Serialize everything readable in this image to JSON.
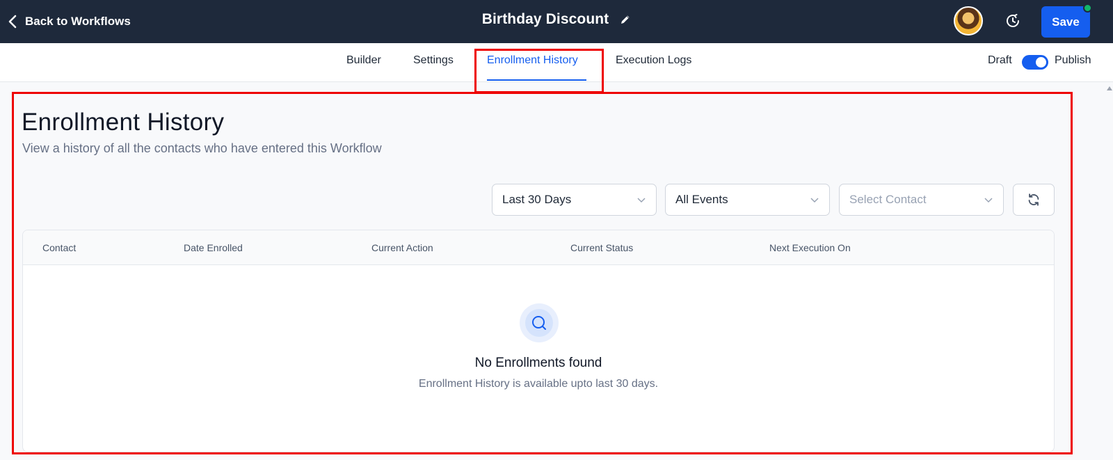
{
  "header": {
    "back_label": "Back to Workflows",
    "workflow_title": "Birthday Discount",
    "save_label": "Save"
  },
  "tabs": [
    {
      "label": "Builder",
      "active": false
    },
    {
      "label": "Settings",
      "active": false
    },
    {
      "label": "Enrollment History",
      "active": true
    },
    {
      "label": "Execution Logs",
      "active": false
    }
  ],
  "publish": {
    "draft_label": "Draft",
    "publish_label": "Publish",
    "published": true
  },
  "page": {
    "title": "Enrollment History",
    "subtitle": "View a history of all the contacts who have entered this Workflow"
  },
  "filters": {
    "date_range": "Last 30 Days",
    "events": "All Events",
    "contact_placeholder": "Select Contact"
  },
  "table": {
    "columns": [
      "Contact",
      "Date Enrolled",
      "Current Action",
      "Current Status",
      "Next Execution On"
    ],
    "rows": []
  },
  "empty_state": {
    "title": "No Enrollments found",
    "subtitle": "Enrollment History is available upto last 30 days."
  },
  "colors": {
    "header_bg": "#1e293b",
    "accent": "#155eef",
    "online": "#12b76a",
    "highlight": "#ee0000"
  },
  "icons": {
    "back": "chevron-left-icon",
    "edit": "pencil-icon",
    "history": "clock-history-icon",
    "dropdown": "chevron-down-icon",
    "refresh": "refresh-icon",
    "empty": "search-icon"
  }
}
